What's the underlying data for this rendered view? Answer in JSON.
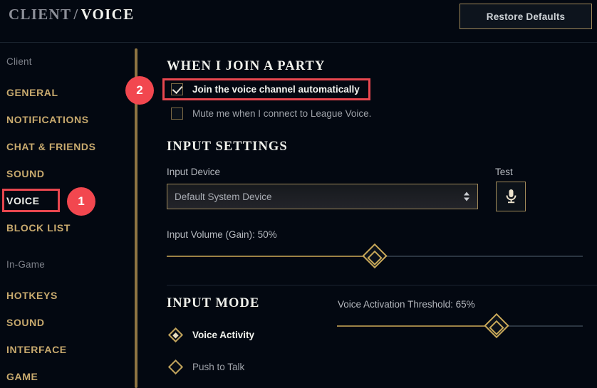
{
  "header": {
    "breadcrumb_root": "CLIENT",
    "breadcrumb_separator": "/",
    "breadcrumb_current": "VOICE",
    "restore_defaults_label": "Restore Defaults"
  },
  "sidebar": {
    "groups": [
      {
        "title": "Client",
        "items": [
          {
            "label": "GENERAL",
            "active": false
          },
          {
            "label": "NOTIFICATIONS",
            "active": false
          },
          {
            "label": "CHAT & FRIENDS",
            "active": false
          },
          {
            "label": "SOUND",
            "active": false
          },
          {
            "label": "VOICE",
            "active": true
          },
          {
            "label": "BLOCK LIST",
            "active": false
          }
        ]
      },
      {
        "title": "In-Game",
        "items": [
          {
            "label": "HOTKEYS",
            "active": false
          },
          {
            "label": "SOUND",
            "active": false
          },
          {
            "label": "INTERFACE",
            "active": false
          },
          {
            "label": "GAME",
            "active": false
          }
        ]
      }
    ]
  },
  "main": {
    "party_section": {
      "title": "WHEN I JOIN A PARTY",
      "checkboxes": [
        {
          "label": "Join the voice channel automatically",
          "checked": true
        },
        {
          "label": "Mute me when I connect to League Voice.",
          "checked": false
        }
      ]
    },
    "input_settings": {
      "title": "INPUT SETTINGS",
      "device_label": "Input Device",
      "device_value": "Default System Device",
      "test_label": "Test",
      "test_icon": "microphone-icon",
      "volume_label": "Input Volume (Gain): 50%",
      "volume_percent": 50
    },
    "input_mode": {
      "title": "INPUT MODE",
      "options": [
        {
          "label": "Voice Activity",
          "selected": true
        },
        {
          "label": "Push to Talk",
          "selected": false
        }
      ],
      "threshold_label": "Voice Activation Threshold: 65%",
      "threshold_percent": 65
    }
  },
  "annotations": {
    "badges": [
      {
        "number": "1"
      },
      {
        "number": "2"
      }
    ]
  },
  "colors": {
    "background": "#030811",
    "gold": "#c8aa6e",
    "accent_red": "#f2474f",
    "text_light": "#f0f1ec",
    "text_muted": "#9ea2a9"
  }
}
